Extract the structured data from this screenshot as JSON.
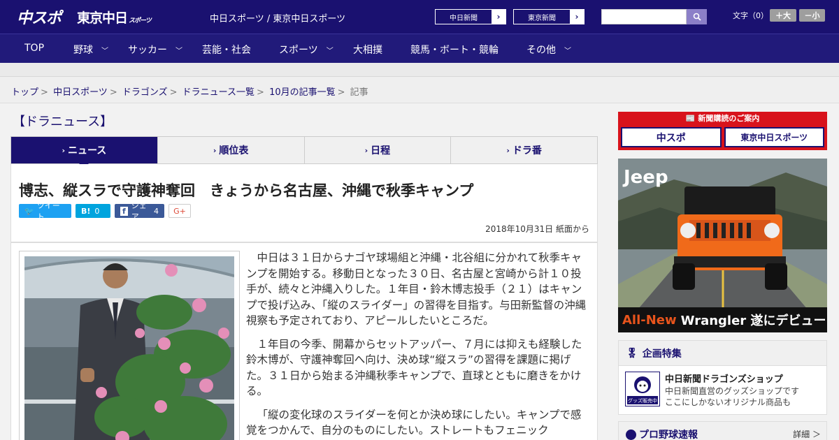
{
  "header": {
    "logo_chunichi": "中スポ",
    "logo_tokyo": "東京中日",
    "logo_tokyo_small": "スポーツ",
    "site_links": "中日スポーツ / 東京中日スポーツ",
    "paper_buttons": [
      "中日新聞",
      "東京新聞"
    ],
    "search_placeholder": "",
    "font_size_label": "文字（0）",
    "size_up": "＋大",
    "size_down": "－小"
  },
  "nav": {
    "items": [
      "TOP",
      "野球",
      "サッカー",
      "芸能・社会",
      "スポーツ",
      "大相撲",
      "競馬・ボート・競輪",
      "その他"
    ]
  },
  "breadcrumb": {
    "items": [
      "トップ",
      "中日スポーツ",
      "ドラゴンズ",
      "ドラニュース一覧",
      "10月の記事一覧"
    ],
    "current": "記事"
  },
  "section_title": "【ドラニュース】",
  "tabs": [
    "ニュース",
    "順位表",
    "日程",
    "ドラ番"
  ],
  "article": {
    "headline": "博志、縦スラで守護神奪回　きょうから名古屋、沖縄で秋季キャンプ",
    "share": {
      "tweet": "ツイート",
      "hatena_count": "0",
      "facebook": "シェア",
      "facebook_count": "4",
      "gplus": "G+"
    },
    "dateline": "2018年10月31日 紙面から",
    "paragraphs": [
      "中日は３１日からナゴヤ球場組と沖縄・北谷組に分かれて秋季キャンプを開始する。移動日となった３０日、名古屋と宮崎から計１０投手が、続々と沖縄入りした。１年目・鈴木博志投手（２１）はキャンプで投げ込み、「縦のスライダー」の習得を目指す。与田新監督の沖縄視察も予定されており、アピールしたいところだ。",
      "１年目の今季、開幕からセットアッパー、７月には抑えも経験した鈴木博が、守護神奪回へ向け、決め球“縦スラ”の習得を課題に掲げた。３１日から始まる沖縄秋季キャンプで、直球とともに磨きをかける。",
      "「縦の変化球のスライダーを何とか決め球にしたい。キャンプで感覚をつかんで、自分のものにしたい。ストレートもフェニック"
    ]
  },
  "sidebar": {
    "subscribe_title": "新聞購読のご案内",
    "subscribe_buttons": [
      "中スポ",
      "東京中日スポーツ"
    ],
    "ad_brand": "Jeep",
    "ad_highlight": "All-New",
    "ad_text": "Wrangler 遂にデビュー",
    "feature_title": "企画特集",
    "shop_title": "中日新聞ドラゴンズショップ",
    "shop_desc": [
      "中日新聞直営のグッズショップです",
      "ここにしかないオリジナル商品も"
    ],
    "shop_badge": "グッズ販売中",
    "speed_title": "プロ野球速報",
    "speed_more": "詳細 ＞"
  },
  "colors": {
    "primary": "#1a1170",
    "subscribe_red": "#d8131c",
    "twitter": "#1da1f2",
    "hatena": "#00a4de",
    "facebook": "#3b5998"
  }
}
